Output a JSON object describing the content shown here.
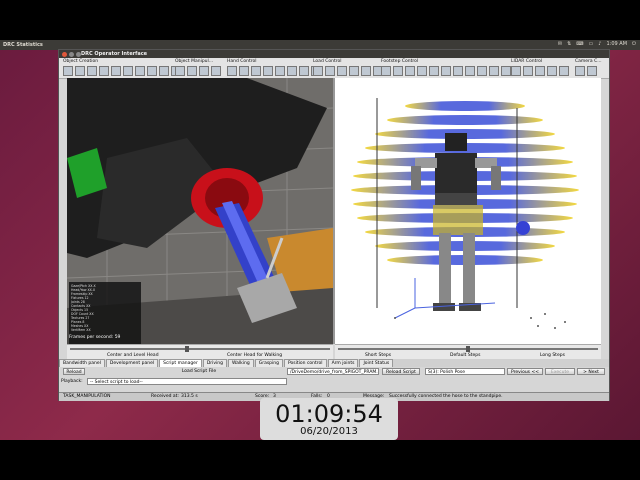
{
  "desktop": {
    "top_app": "DRC Statistics",
    "tray_time": "1:09 AM"
  },
  "window": {
    "title": "DRC Operator Interface"
  },
  "toolbar": {
    "groups": [
      {
        "label": "Object Creation"
      },
      {
        "label": "Object Manipul..."
      },
      {
        "label": "Hand Control"
      },
      {
        "label": "Load Control"
      },
      {
        "label": "Footstep Control"
      },
      {
        "label": "LIDAR Control"
      },
      {
        "label": "Camera C..."
      }
    ]
  },
  "left_view": {
    "stats_lines": [
      "Gaze/Ptch XX.X",
      "Head/Yaw XX.X",
      "Frameskip XX",
      "Fixtures 12",
      "Joints 28",
      "Contacts XX",
      "Objects 15",
      "DOF Count XX",
      "Textures 27",
      "Planes 8",
      "Meshes XX",
      "VertMem XX",
      "Bytes XX"
    ],
    "fps_label": "Frames per second: 59"
  },
  "sliders": {
    "left": {
      "left_label": "Center and Level Head",
      "right_label": "Center Head for Walking",
      "value_pct": 0.45
    },
    "right": {
      "left_label": "Short Steps",
      "mid_label": "Default Steps",
      "right_label": "Long Steps",
      "value_pct": 0.5
    }
  },
  "tabs": [
    {
      "label": "Bandwidth panel"
    },
    {
      "label": "Development panel"
    },
    {
      "label": "Script manager"
    },
    {
      "label": "Driving"
    },
    {
      "label": "Walking"
    },
    {
      "label": "Grasping"
    },
    {
      "label": "Position control"
    },
    {
      "label": "Arm joints"
    },
    {
      "label": "Joint Status"
    }
  ],
  "script_row": {
    "reload_btn": "Reload",
    "load_script": "Load Script File",
    "script_path": "/DriveDemo/drive_from_SPIGOT_PRAM.xml",
    "reload_script": "Reload Script",
    "step_field": "S(3): Polish Pose",
    "previous": "Previous <<",
    "execute": "Execute",
    "next": "> Next"
  },
  "playback_row": {
    "label": "Playback:",
    "select_placeholder": "-- Select script to load--"
  },
  "status": {
    "mode": "TASK_MANIPULATION",
    "received_label": "Received at:",
    "received_value": "313.5 s",
    "score_label": "Score:",
    "score_value": "3",
    "falls_label": "Falls:",
    "falls_value": "0",
    "message_label": "Message:",
    "message_value": "Successfully connected the hose to the standpipe."
  },
  "clock": {
    "time": "01:09:54",
    "date": "06/20/2013"
  },
  "colors": {
    "accent_red": "#d4101a",
    "valve_blue": "#2f3fd8",
    "robot_dark": "#1b1b1b",
    "desktop_magenta": "#7a2244"
  }
}
